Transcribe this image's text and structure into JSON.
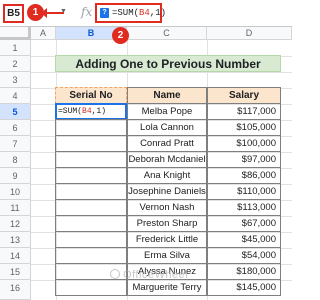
{
  "formula_bar": {
    "name_box": "B5",
    "callout_1": "1",
    "callout_2": "2",
    "fx_label": "fx",
    "query_icon_glyph": "?",
    "formula_prefix": "=SUM(",
    "formula_ref": "B4",
    "formula_suffix": ",1)"
  },
  "columns": [
    "A",
    "B",
    "C",
    "D"
  ],
  "selected_column": "B",
  "rows": [
    "1",
    "2",
    "3",
    "4",
    "5",
    "6",
    "7",
    "8",
    "9",
    "10",
    "11",
    "12",
    "13",
    "14",
    "15",
    "16"
  ],
  "selected_row": "5",
  "sheet": {
    "title": "Adding One to Previous Number",
    "title_fill": "#d9ead3",
    "header_fill": "#fce5cd",
    "headers": [
      "Serial No",
      "Name",
      "Salary"
    ],
    "active_cell_prefix": "=SUM(",
    "active_cell_ref": "B4",
    "active_cell_suffix": ",1)",
    "records": [
      {
        "name": "Melba Pope",
        "salary": "$117,000"
      },
      {
        "name": "Lola Cannon",
        "salary": "$105,000"
      },
      {
        "name": "Conrad Pratt",
        "salary": "$100,000"
      },
      {
        "name": "Deborah Mcdaniel",
        "salary": "$97,000"
      },
      {
        "name": "Ana Knight",
        "salary": "$86,000"
      },
      {
        "name": "Josephine Daniels",
        "salary": "$110,000"
      },
      {
        "name": "Vernon Nash",
        "salary": "$113,000"
      },
      {
        "name": "Preston Sharp",
        "salary": "$67,000"
      },
      {
        "name": "Frederick Little",
        "salary": "$45,000"
      },
      {
        "name": "Erma Silva",
        "salary": "$54,000"
      },
      {
        "name": "Alyssa Nunez",
        "salary": "$180,000"
      },
      {
        "name": "Marguerite Terry",
        "salary": "$145,000"
      }
    ]
  },
  "watermark": "OfficeWheel"
}
